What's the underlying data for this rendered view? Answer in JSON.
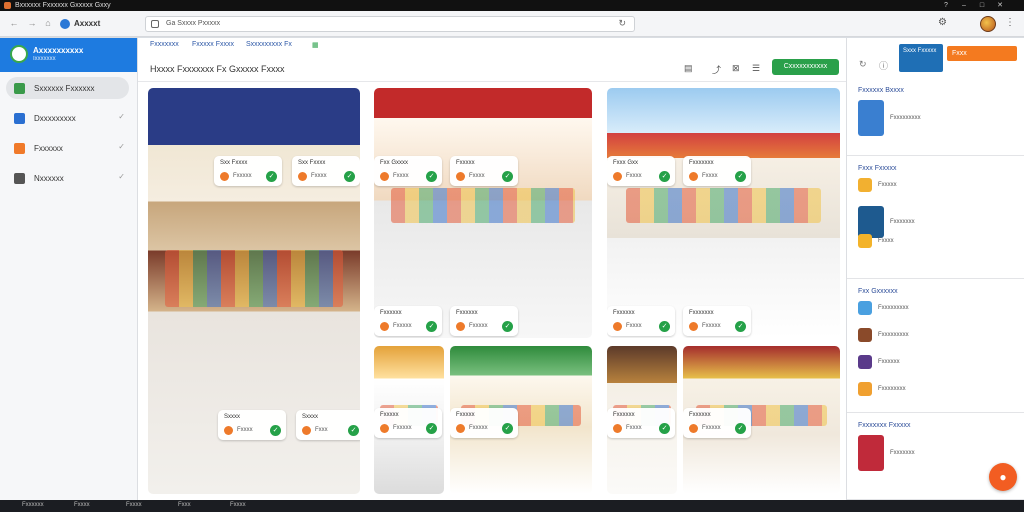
{
  "window": {
    "title": "Bxxxxxx Fxxxxxx Gxxxxx Gxxy",
    "controls": [
      "?",
      "–",
      "□",
      "✕"
    ]
  },
  "browser": {
    "site_name": "Axxxxt",
    "address": "Ga   Sxxxx Pxxxxx",
    "reload_icon": "reload-icon"
  },
  "sidebar": {
    "title": "Axxxxxxxxxx",
    "subtitle": "Ixxxxxxx",
    "items": [
      {
        "label": "Sxxxxxx Fxxxxxx",
        "icon": "store-icon",
        "color": "#3a9a4a",
        "active": true
      },
      {
        "label": "Dxxxxxxxxx",
        "icon": "layers-icon",
        "color": "#2a6fd1",
        "active": false
      },
      {
        "label": "Fxxxxxx",
        "icon": "folder-icon",
        "color": "#f07a2a",
        "active": false
      },
      {
        "label": "Nxxxxxx",
        "icon": "document-icon",
        "color": "#555555",
        "active": false
      }
    ]
  },
  "toolbar": {
    "links": [
      "Fxxxxxxx",
      "Fxxxxx Fxxxx",
      "Sxxxxxxxxx Fx"
    ]
  },
  "main": {
    "title": "Hxxxx Fxxxxxxx Fx Gxxxxx Fxxxx",
    "create_label": "Cxxxxxxxxxxx"
  },
  "tiles": [
    {
      "scene": "a",
      "cards": [
        {
          "cap": "Sxx Fxxxx",
          "label": "Fxxxxx"
        },
        {
          "cap": "Sxx Fxxxx",
          "label": "Fxxxx"
        },
        {
          "cap": "Sxxxx",
          "label": "Fxxxx"
        },
        {
          "cap": "Sxxxx",
          "label": "Fxxx"
        }
      ]
    },
    {
      "scene": "b",
      "cards": [
        {
          "cap": "Fxx Gxxxx",
          "label": "Fxxxx"
        },
        {
          "cap": "Fxxxxx",
          "label": "Fxxxx"
        },
        {
          "cap": "Fxxxxxx",
          "label": "Fxxxxx"
        },
        {
          "cap": "Fxxxxxx",
          "label": "Fxxxxx"
        }
      ]
    },
    {
      "scene": "c",
      "cards": [
        {
          "cap": "Fxxx Gxx",
          "label": "Fxxxx"
        },
        {
          "cap": "Fxxxxxxx",
          "label": "Fxxxx"
        },
        {
          "cap": "Fxxxxxx",
          "label": "Fxxxx"
        },
        {
          "cap": "Fxxxxxxx",
          "label": "Fxxxxx"
        }
      ]
    },
    {
      "scene": "d",
      "cards": [
        {
          "cap": "Fxxxxx",
          "label": "Fxxxxx"
        }
      ]
    },
    {
      "scene": "e",
      "cards": [
        {
          "cap": "Fxxxxx",
          "label": "Fxxxxx"
        }
      ]
    },
    {
      "scene": "f",
      "cards": [
        {
          "cap": "Fxxxxxx",
          "label": "Fxxxx"
        }
      ]
    },
    {
      "scene": "g",
      "cards": [
        {
          "cap": "Fxxxxxx",
          "label": "Fxxxxx"
        }
      ]
    }
  ],
  "right_panel": {
    "blue_box": "Sxxx Fxxxxx",
    "orange_button": "Fxxx",
    "sections": [
      {
        "heading": "Fxxxxxx   Bxxxx",
        "rows": [
          {
            "label": "Fxxxxxxxxx",
            "thumb": "#3a7fd0"
          }
        ]
      },
      {
        "heading": "Fxxx Fxxxxx",
        "rows": [
          {
            "label": "Fxxxxx",
            "thumb": "#f2b030"
          },
          {
            "label": "Fxxxxxxx",
            "thumb": "#1e5a8f"
          },
          {
            "label": "Fxxxx",
            "thumb": "#f3b32a"
          }
        ]
      },
      {
        "heading": "Fxx Gxxxxxx",
        "rows": [
          {
            "label": "Fxxxxxxxxx",
            "thumb": "#4aa0e0"
          },
          {
            "label": "Fxxxxxxxxx",
            "thumb": "#8a4a2a"
          },
          {
            "label": "Fxxxxxx",
            "thumb": "#5a3a8a"
          },
          {
            "label": "Fxxxxxxxx",
            "thumb": "#f0a030"
          }
        ]
      },
      {
        "heading": "Fxxxxxxx Fxxxxx",
        "rows": [
          {
            "label": "Fxxxxxxx",
            "thumb": "#c02a3a"
          }
        ]
      }
    ]
  },
  "taskbar": {
    "items": [
      "Fxxxxxx",
      "Fxxxx",
      "Fxxxx",
      "Fxxx",
      "Fxxxx"
    ]
  }
}
